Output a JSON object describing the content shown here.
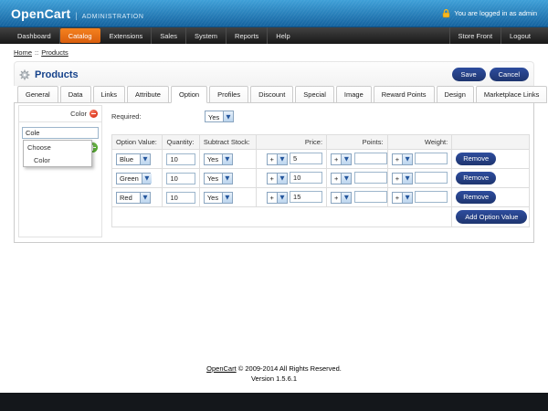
{
  "header": {
    "brand": "OpenCart",
    "divider": "|",
    "brand_suffix": "ADMINISTRATION",
    "logged_in": "You are logged in as admin"
  },
  "nav": {
    "items": [
      "Dashboard",
      "Catalog",
      "Extensions",
      "Sales",
      "System",
      "Reports",
      "Help"
    ],
    "active": "Catalog",
    "store_front": "Store Front",
    "logout": "Logout"
  },
  "breadcrumb": {
    "home": "Home",
    "separator": "::",
    "current": "Products"
  },
  "page": {
    "title": "Products",
    "save_label": "Save",
    "cancel_label": "Cancel"
  },
  "tabs": {
    "items": [
      "General",
      "Data",
      "Links",
      "Attribute",
      "Option",
      "Profiles",
      "Discount",
      "Special",
      "Image",
      "Reward Points",
      "Design",
      "Marketplace Links"
    ],
    "active": "Option"
  },
  "sidebar": {
    "selected_option": "Color",
    "autocomplete_value": "Cole",
    "dropdown": {
      "group": "Choose",
      "item": "Color"
    }
  },
  "form": {
    "required_label": "Required:",
    "required_value": "Yes"
  },
  "option_table": {
    "headers": [
      "Option Value:",
      "Quantity:",
      "Subtract Stock:",
      "Price:",
      "Points:",
      "Weight:"
    ],
    "rows": [
      {
        "option_value": "Blue",
        "quantity": "10",
        "subtract_stock": "Yes",
        "price_op": "+",
        "price": "5",
        "points_op": "+",
        "points": "",
        "weight_op": "+",
        "weight": ""
      },
      {
        "option_value": "Green",
        "quantity": "10",
        "subtract_stock": "Yes",
        "price_op": "+",
        "price": "10",
        "points_op": "+",
        "points": "",
        "weight_op": "+",
        "weight": ""
      },
      {
        "option_value": "Red",
        "quantity": "10",
        "subtract_stock": "Yes",
        "price_op": "+",
        "price": "15",
        "points_op": "+",
        "points": "",
        "weight_op": "+",
        "weight": ""
      }
    ],
    "remove_label": "Remove",
    "add_label": "Add Option Value"
  },
  "footer": {
    "link": "OpenCart",
    "copyright": "© 2009-2014 All Rights Reserved.",
    "version": "Version 1.5.6.1"
  },
  "colors": {
    "header_blue": "#2a83bd",
    "accent_orange": "#e8671a",
    "button_navy": "#24408b",
    "remove_red": "#dd3a22",
    "add_green": "#53a82e"
  }
}
